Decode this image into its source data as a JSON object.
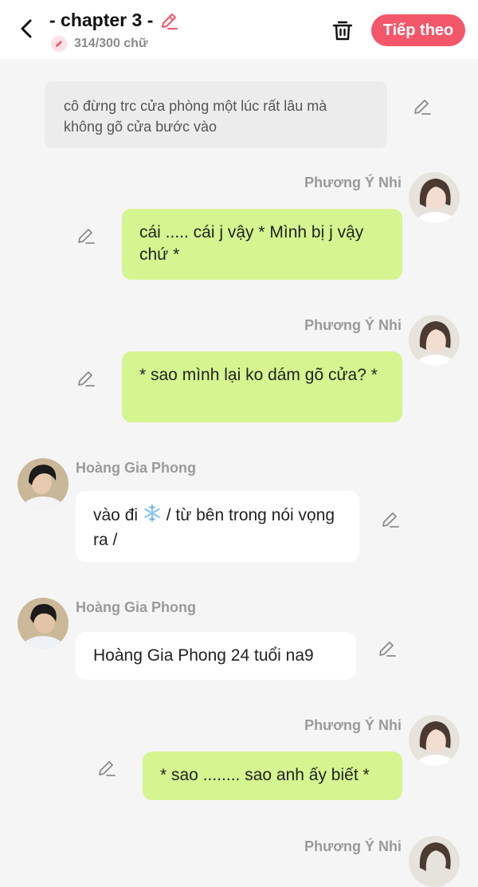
{
  "header": {
    "title": "- chapter 3 -",
    "word_count": "314/300 chữ",
    "next_label": "Tiếp theo",
    "accent_color": "#f4566a"
  },
  "messages": [
    {
      "type": "narration",
      "text": "cô đừng trc cửa phòng một lúc rất lâu mà không gõ cửa bước vào"
    },
    {
      "type": "right",
      "sender": "Phương Ý Nhi",
      "text": "cái ..... cái j vậy * Mình bị j vậy chứ *"
    },
    {
      "type": "right",
      "sender": "Phương Ý Nhi",
      "text": "* sao mình lại ko dám gõ cửa? *"
    },
    {
      "type": "left",
      "sender": "Hoàng Gia Phong",
      "text_before": "vào đi",
      "text_after": " / từ bên trong nói vọng ra /"
    },
    {
      "type": "left",
      "sender": "Hoàng Gia Phong",
      "text": "Hoàng Gia Phong  24 tuổi na9"
    },
    {
      "type": "right",
      "sender": "Phương Ý Nhi",
      "text": "* sao ........ sao anh ấy biết *"
    },
    {
      "type": "right",
      "sender": "Phương Ý Nhi"
    }
  ],
  "colors": {
    "right_bubble": "#d4f58f",
    "left_bubble": "#ffffff",
    "narration_bg": "#ececec",
    "background": "#f5f5f5"
  }
}
